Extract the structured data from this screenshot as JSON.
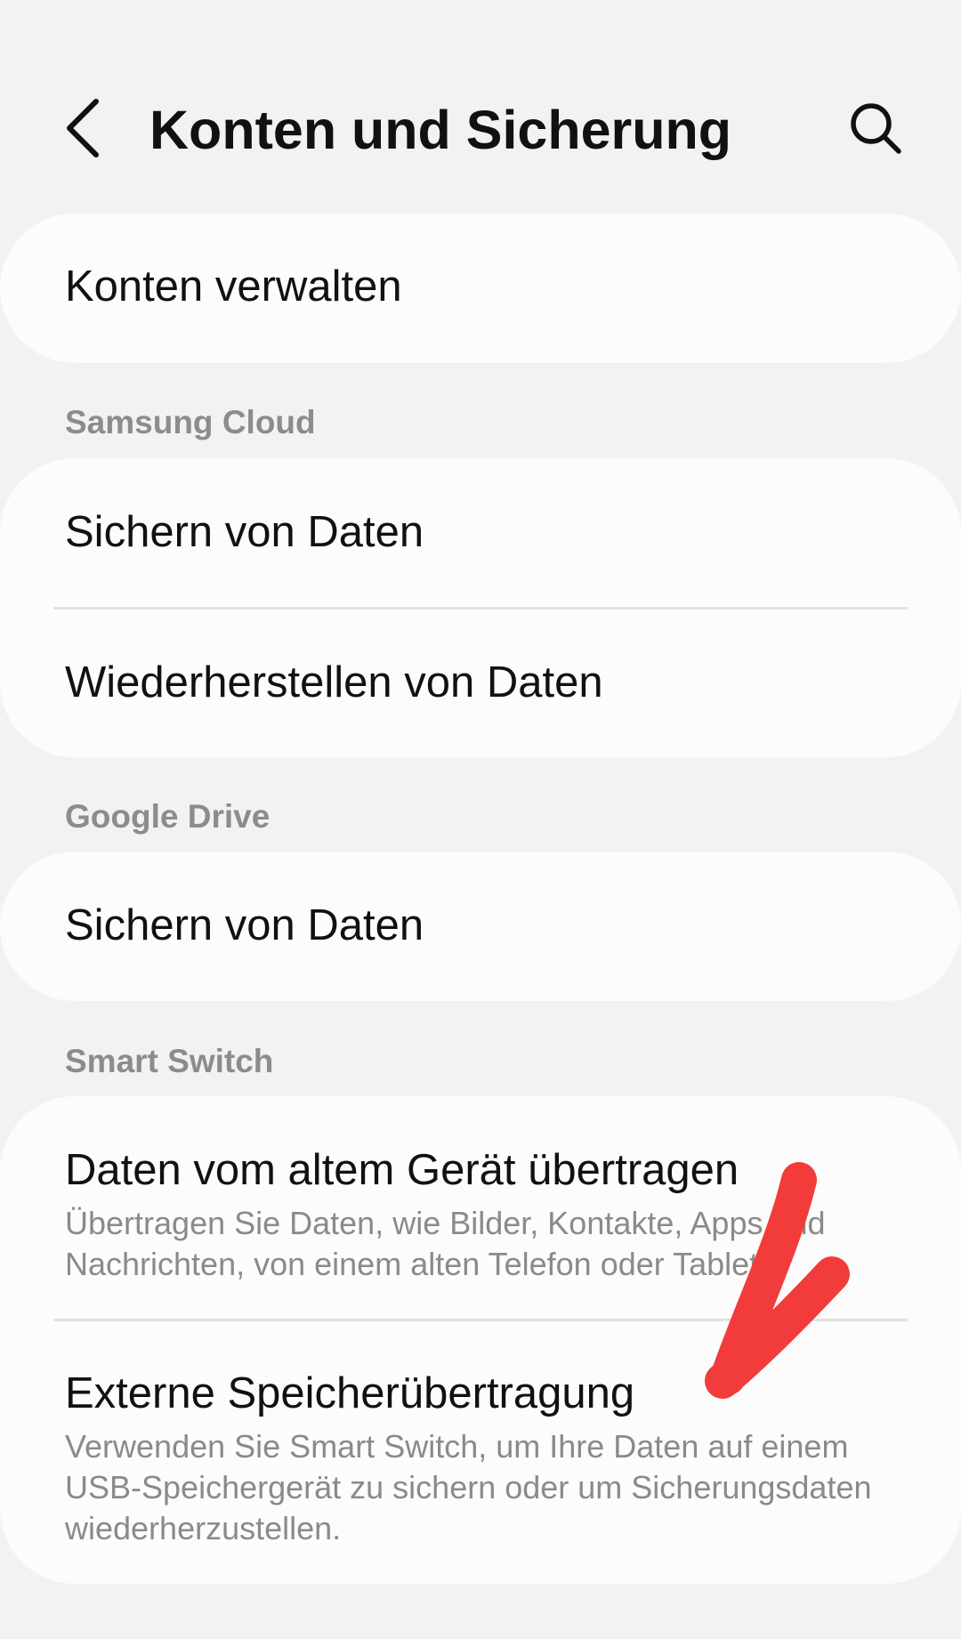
{
  "header": {
    "title": "Konten und Sicherung",
    "back_icon": "chevron-left-icon",
    "search_icon": "search-icon"
  },
  "accounts": {
    "manage_label": "Konten verwalten"
  },
  "samsung_cloud": {
    "section_label": "Samsung Cloud",
    "backup_label": "Sichern von Daten",
    "restore_label": "Wiederherstellen von Daten"
  },
  "google_drive": {
    "section_label": "Google Drive",
    "backup_label": "Sichern von Daten"
  },
  "smart_switch": {
    "section_label": "Smart Switch",
    "transfer_label": "Daten vom altem Gerät übertragen",
    "transfer_description": "Übertragen Sie Daten, wie Bilder, Kontakte, Apps und Nachrichten, von einem alten Telefon oder Tablet",
    "external_label": "Externe Speicherübertragung",
    "external_description": "Verwenden Sie Smart Switch, um Ihre Daten auf einem USB-Speichergerät zu sichern oder um Sicherungsdaten wiederherzustellen."
  },
  "colors": {
    "background": "#f2f2f2",
    "card": "#fcfcfc",
    "section_label": "#8c8c8c",
    "annotation_arrow": "#f23c3c"
  },
  "annotation": {
    "icon": "red-arrow-annotation"
  }
}
